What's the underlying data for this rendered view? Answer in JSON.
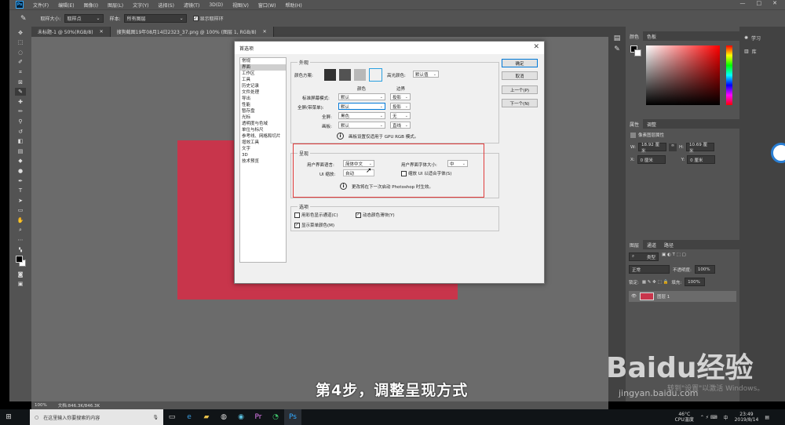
{
  "menubar": {
    "logo": "Ps",
    "items": [
      "文件(F)",
      "编辑(E)",
      "图像(I)",
      "图层(L)",
      "文字(Y)",
      "选择(S)",
      "滤镜(T)",
      "3D(D)",
      "视图(V)",
      "窗口(W)",
      "帮助(H)"
    ],
    "window_buttons": [
      "—",
      "□",
      "✕"
    ]
  },
  "optionsbar": {
    "sample_size_label": "取样大小:",
    "sample_size_value": "取样点",
    "sample_label": "样本:",
    "sample_value": "所有图层",
    "show_ring_label": "显示取样环"
  },
  "doc_tabs": [
    {
      "label": "未标题-1 @ 50%(RGB/8)",
      "close": "✕"
    },
    {
      "label": "搜狗截图19年08月14日2323_37.png @ 100% (图层 1, RGB/8)",
      "close": "✕"
    }
  ],
  "statusbar": {
    "zoom": "100%",
    "doc_info": "文档:846.3K/846.3K"
  },
  "right_panels": {
    "color_tabs": [
      "颜色",
      "色板"
    ],
    "props_tabs": [
      "属性",
      "调整"
    ],
    "props_title": "像素图层属性",
    "props_w_label": "W:",
    "props_w": "18.92 厘米",
    "props_h_label": "H:",
    "props_h": "10.69 厘米",
    "props_x_label": "X:",
    "props_x": "0 厘米",
    "props_y_label": "Y:",
    "props_y": "0 厘米",
    "layer_tabs": [
      "图层",
      "通道",
      "路径"
    ],
    "layer_kind": "类型",
    "layer_blend": "正常",
    "layer_opacity_label": "不透明度:",
    "layer_opacity": "100%",
    "layer_lock_label": "锁定:",
    "layer_fill_label": "填充:",
    "layer_fill": "100%",
    "layer_name": "图层 1",
    "learn_label": "学习",
    "library_label": "库"
  },
  "dialog": {
    "title": "首选项",
    "close": "✕",
    "nav": [
      "常规",
      "界面",
      "工作区",
      "工具",
      "历史记录",
      "文件处理",
      "导出",
      "性能",
      "暂存盘",
      "光标",
      "透明度与色域",
      "单位与标尺",
      "参考线、网格和切片",
      "增效工具",
      "文字",
      "3D",
      "技术预览"
    ],
    "nav_selected": 1,
    "buttons": {
      "ok": "确定",
      "cancel": "取消",
      "prev": "上一个(P)",
      "next": "下一个(N)"
    },
    "appearance": {
      "label": "外观",
      "color_scheme_label": "颜色方案:",
      "swatch_colors": [
        "#323232",
        "#535353",
        "#b8b8b8",
        "#f0f0f0"
      ],
      "highlight_label": "高光颜色:",
      "highlight_value": "默认值",
      "col_color": "颜色",
      "col_border": "边界",
      "rows": [
        {
          "label": "标准屏幕模式:",
          "color": "默认",
          "border": "投影"
        },
        {
          "label": "全屏(带菜单):",
          "color": "默认",
          "border": "投影"
        },
        {
          "label": "全屏:",
          "color": "黑色",
          "border": "无"
        },
        {
          "label": "画板:",
          "color": "默认",
          "border": "直线"
        }
      ],
      "note": "画板设置仅适用于 GPU RGB 模式。"
    },
    "presentation": {
      "label": "呈现",
      "ui_language_label": "用户界面语言:",
      "ui_language": "简体中文",
      "ui_font_size_label": "用户界面字体大小:",
      "ui_font_size": "中",
      "ui_scaling_label": "UI 缩放:",
      "ui_scaling": "自动",
      "scale_fonts_label": "缩放 UI 以适合字体(S)",
      "note": "更改将在下一次启动 Photoshop 时生效。"
    },
    "options": {
      "label": "选项",
      "channels_color_label": "用彩色显示通道(C)",
      "dynamic_sliders_label": "动态颜色滑块(Y)",
      "menu_colors_label": "显示菜单颜色(M)"
    }
  },
  "caption": "第4步，调整呈现方式",
  "watermark": {
    "main": "Baidu经验",
    "sub": "jingyan.baidu.com",
    "activate": "转到\"设置\"以激活 Windows。"
  },
  "taskbar": {
    "search_placeholder": "在这里输入你要搜索的内容",
    "weather": "46°C",
    "cpu": "CPU温度",
    "ime": "中",
    "time": "23:49",
    "date": "2019/8/14"
  }
}
